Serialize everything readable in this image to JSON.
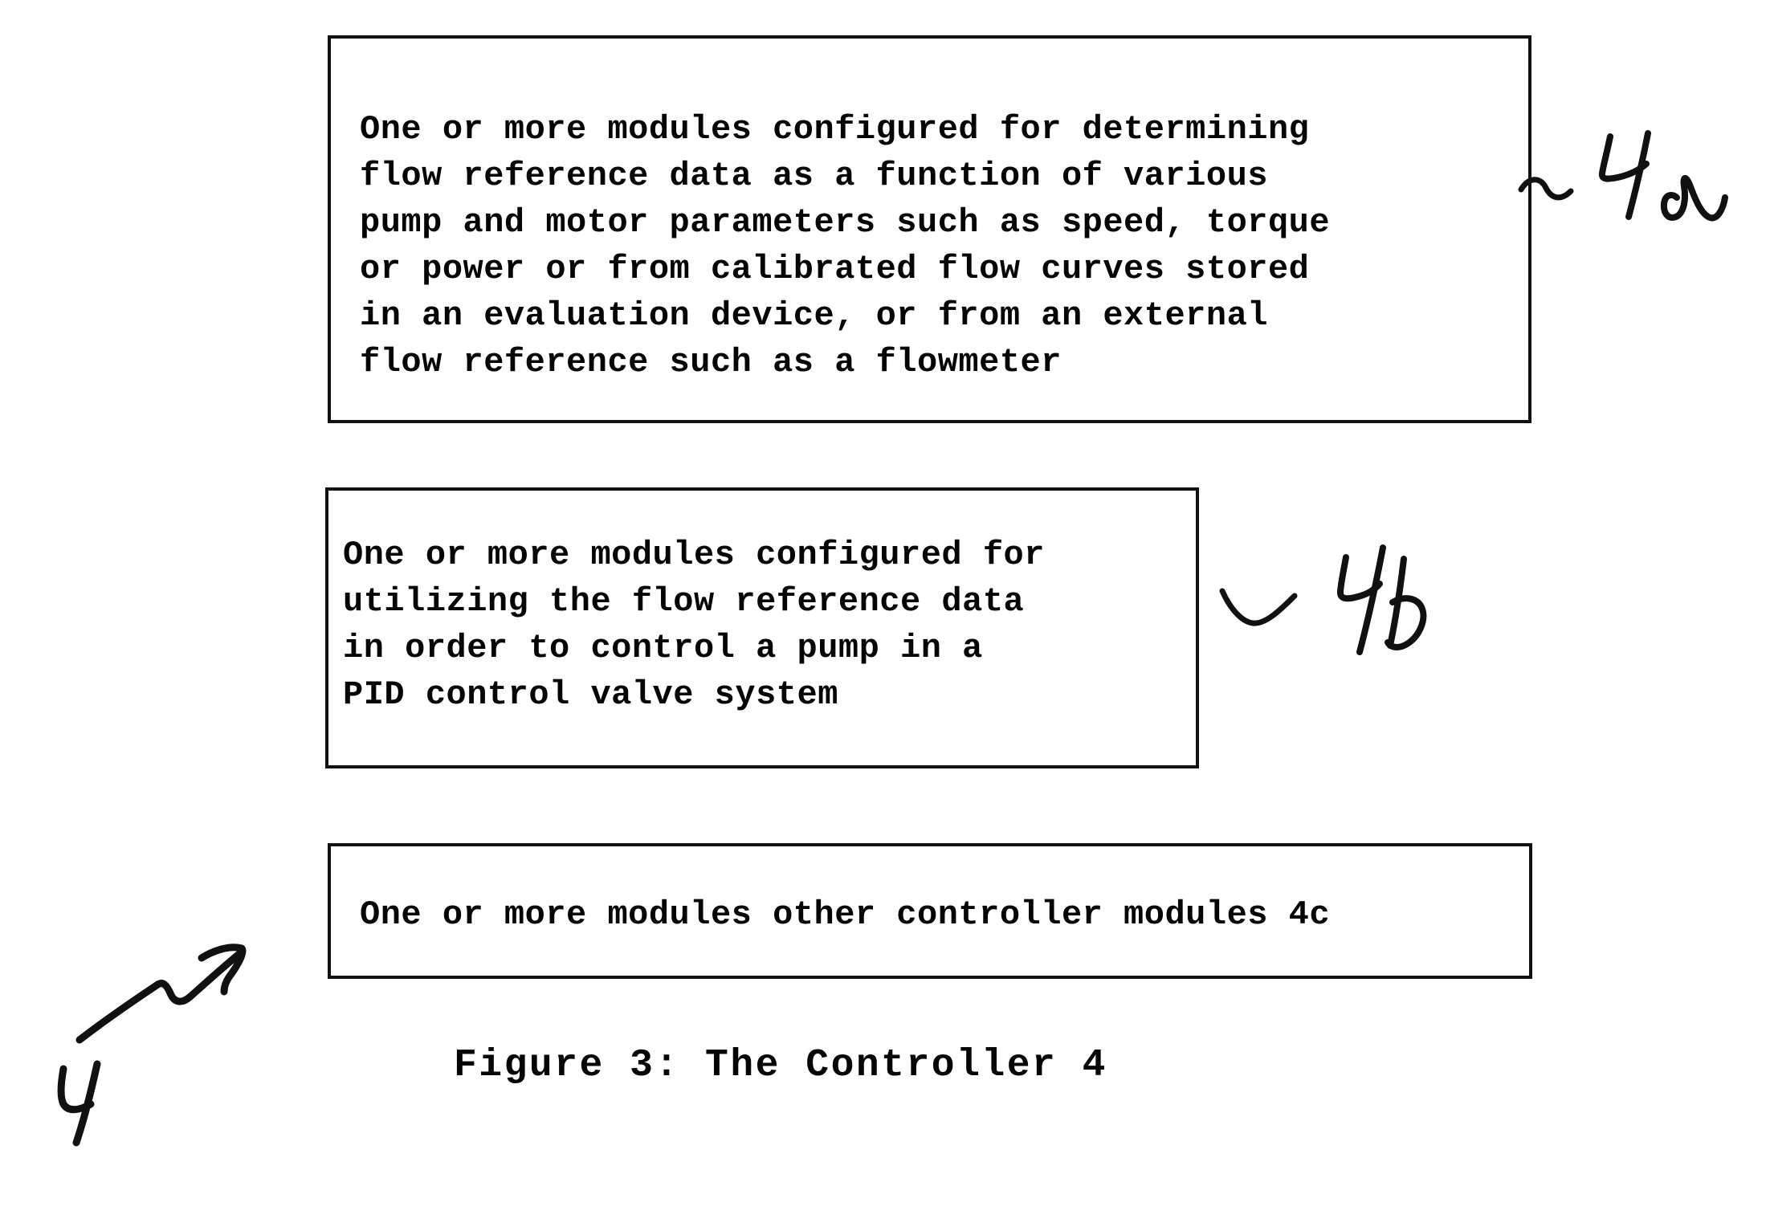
{
  "figure": {
    "caption": "Figure 3: The Controller 4",
    "number": "3",
    "title": "The Controller 4"
  },
  "boxes": [
    {
      "id": "4a",
      "text": "One or more modules configured for determining\nflow reference data as a function of various\npump and motor parameters such as speed, torque\nor power or from calibrated flow curves stored\nin an evaluation device, or from an external\nflow reference such as a flowmeter",
      "lines": [
        "One or more modules configured for determining",
        "flow reference data as a function of various",
        "pump and motor parameters such as speed, torque",
        "or power or from calibrated flow curves stored",
        "in an evaluation device, or from an external",
        "flow reference such as a flowmeter"
      ]
    },
    {
      "id": "4b",
      "text": "One or more modules configured for\nutilizing the flow reference data\nin order to control a pump in a\nPID control valve system",
      "lines": [
        "One or more modules configured for",
        "utilizing the flow reference data",
        "in order to control a pump in a",
        "PID control valve system"
      ]
    },
    {
      "id": "4c",
      "text": "One or more modules other controller modules 4c",
      "lines": [
        "One or more modules other controller modules 4c"
      ]
    }
  ],
  "annotations": {
    "ref_4a": "4a",
    "ref_4b": "4b",
    "ref_4": "4"
  },
  "colors": {
    "ink": "#111111",
    "paper": "#ffffff"
  }
}
